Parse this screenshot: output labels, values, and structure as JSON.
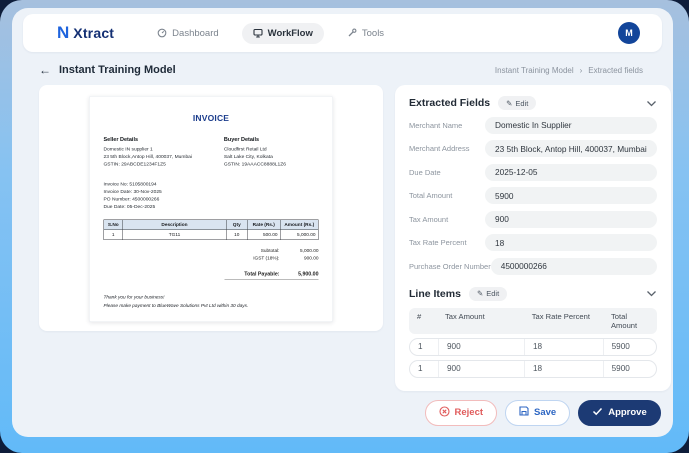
{
  "colors": {
    "frame_blue": "#62baf8",
    "background_navy": "#0e1d3a",
    "brand_navy": "#132f73",
    "brand_blue": "#1e63dd",
    "approve_navy": "#1c3a74",
    "reject_red": "#e05b5b",
    "save_blue": "#2d66c3",
    "invoice_heading_blue": "#1b3c8c",
    "field_pill_gray": "#f1f3f4"
  },
  "icons": {
    "back": "←",
    "crumb_separator": "›",
    "edit_pencil": "✎"
  },
  "app": {
    "brand": "Xtract",
    "brand_initial": "N",
    "nav": [
      {
        "label": "Dashboard"
      },
      {
        "label": "WorkFlow"
      },
      {
        "label": "Tools"
      }
    ],
    "avatar": "M"
  },
  "page": {
    "title": "Instant Training Model",
    "breadcrumb": [
      "Instant Training Model",
      "Extracted fields"
    ]
  },
  "invoice": {
    "title": "INVOICE",
    "seller": {
      "heading": "Seller Details",
      "lines": [
        "Domestic IN supplier 1",
        "23 5th Block,Antop Hill, 400037, Mumbai",
        "GSTIN: 29ABCDE1234F1Z5"
      ]
    },
    "buyer": {
      "heading": "Buyer Details",
      "lines": [
        "Cloudfirst Retail Ltd",
        "Salt Lake City, Kolkata",
        "GSTIN: 19AAACC8888L1Z6"
      ]
    },
    "meta": [
      "Invoice No: 5105800194",
      "Invoice Date: 30-Nov-2025",
      "PO Number: 4500000266",
      "Due Date: 05-Dec-2025"
    ],
    "table": {
      "headers": [
        "S.No",
        "Description",
        "Qty",
        "Rate (Rs.)",
        "Amount (Rs.)"
      ],
      "rows": [
        [
          "1",
          "TG11",
          "10",
          "500.00",
          "5,000.00"
        ]
      ]
    },
    "totals": [
      {
        "label": "Subtotal:",
        "value": "5,000.00"
      },
      {
        "label": "IGST (18%):",
        "value": "900.00"
      }
    ],
    "total_payable": {
      "label": "Total Payable:",
      "value": "5,900.00"
    },
    "footer": [
      "Thank you for your business!",
      "Please make payment to BlueWave Solutions Pvt Ltd within 30 days."
    ]
  },
  "extracted_fields": {
    "title": "Extracted Fields",
    "edit_label": "Edit",
    "fields": [
      {
        "label": "Merchant Name",
        "value": "Domestic In Supplier"
      },
      {
        "label": "Merchant Address",
        "value": "23 5th Block, Antop Hill, 400037, Mumbai"
      },
      {
        "label": "Due Date",
        "value": "2025-12-05"
      },
      {
        "label": "Total Amount",
        "value": "5900"
      },
      {
        "label": "Tax Amount",
        "value": "900"
      },
      {
        "label": "Tax Rate Percent",
        "value": "18"
      },
      {
        "label": "Purchase Order Number",
        "value": "4500000266"
      }
    ]
  },
  "line_items": {
    "title": "Line Items",
    "edit_label": "Edit",
    "headers": [
      "#",
      "Tax Amount",
      "Tax Rate Percent",
      "Total Amount"
    ],
    "rows": [
      [
        "1",
        "900",
        "18",
        "5900"
      ],
      [
        "1",
        "900",
        "18",
        "5900"
      ]
    ]
  },
  "actions": {
    "reject": "Reject",
    "save": "Save",
    "approve": "Approve"
  }
}
